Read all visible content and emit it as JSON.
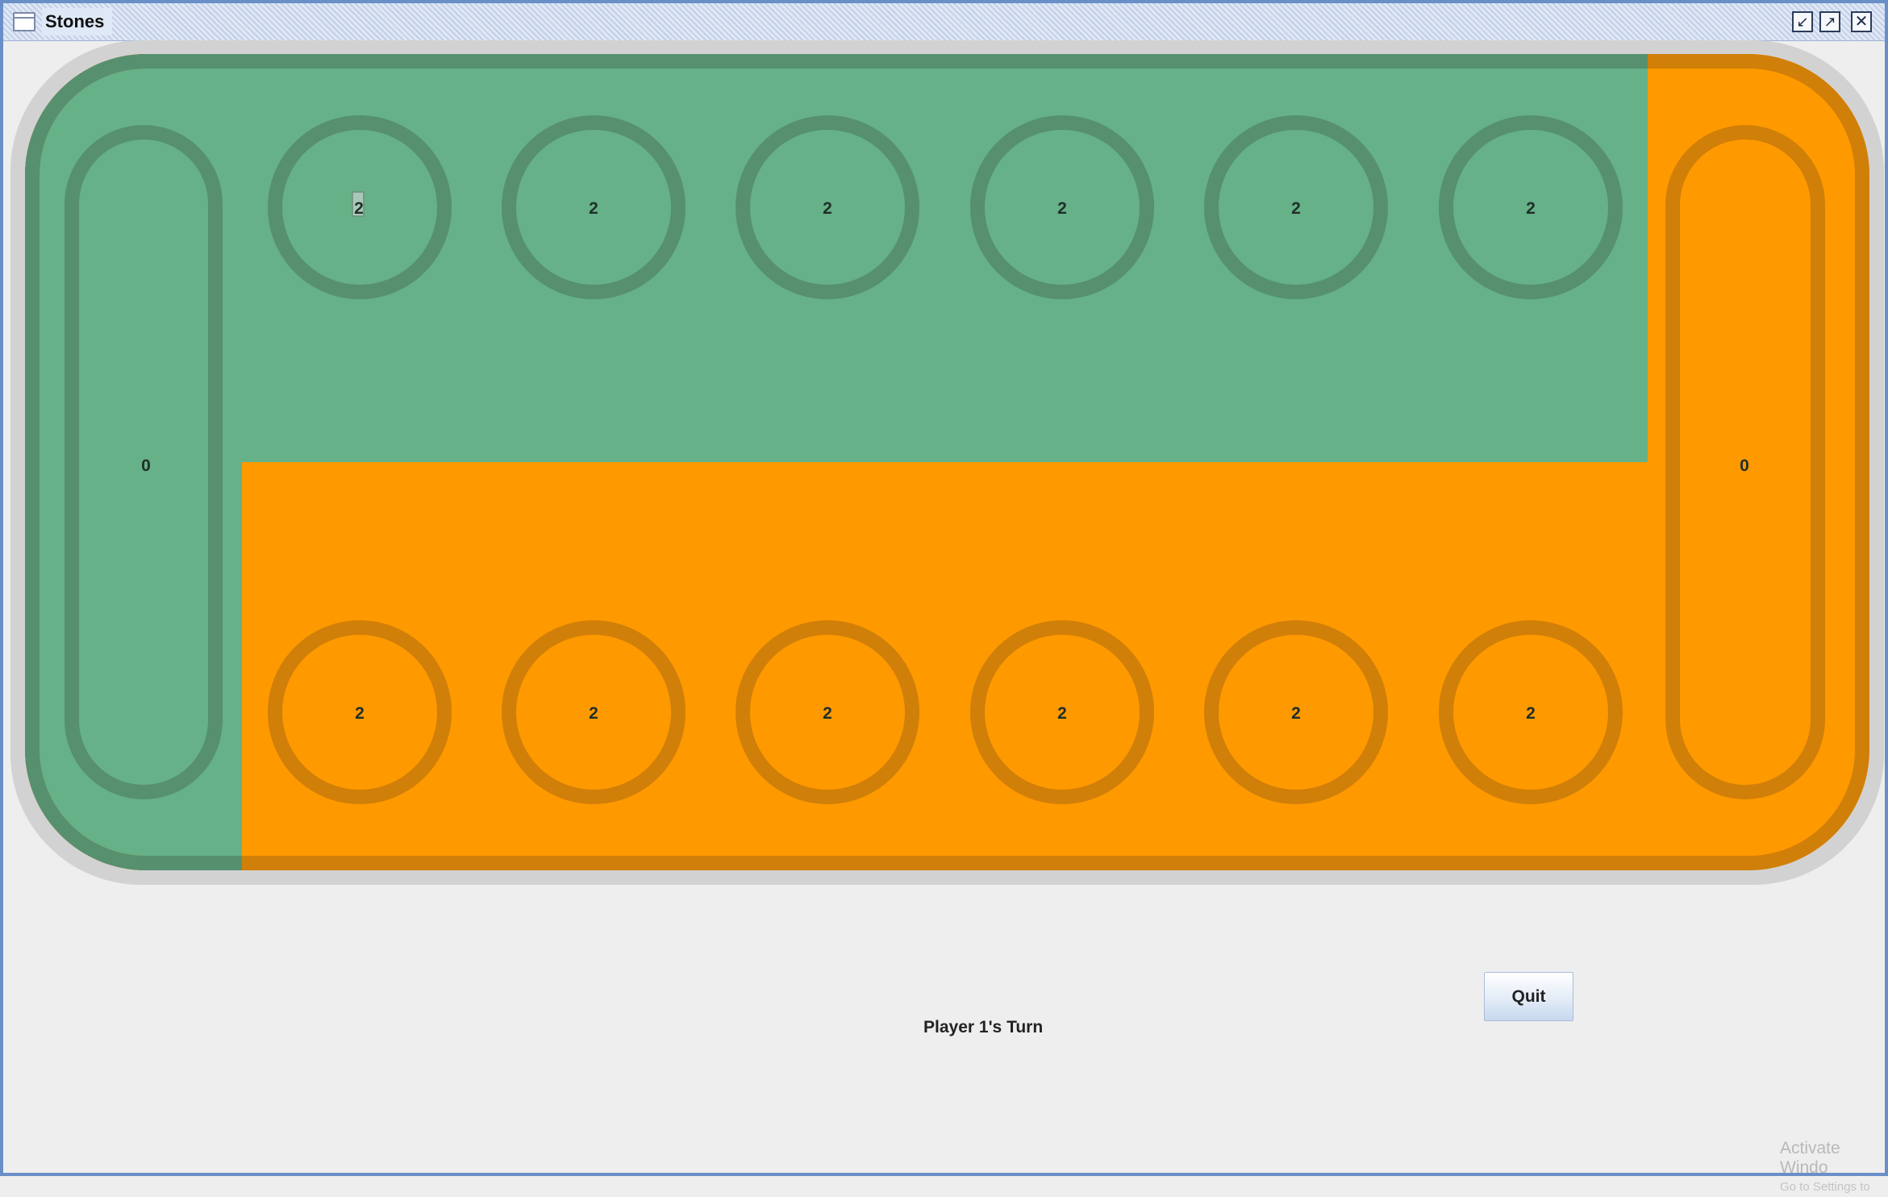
{
  "window": {
    "title": "Stones"
  },
  "title_buttons": {
    "minimize": "minimize-icon",
    "maximize": "maximize-icon",
    "close": "close-icon"
  },
  "board": {
    "colors": {
      "player1": "#66b187",
      "player1_ring": "#56906f",
      "player2": "#ff9900",
      "player2_ring": "#d07f09",
      "rim": "#d2d2d2"
    },
    "store_left": "0",
    "store_right": "0",
    "top_pits": [
      "2",
      "2",
      "2",
      "2",
      "2",
      "2"
    ],
    "bottom_pits": [
      "2",
      "2",
      "2",
      "2",
      "2",
      "2"
    ]
  },
  "status": {
    "turn": "Player 1's Turn"
  },
  "controls": {
    "quit_label": "Quit"
  },
  "watermark": {
    "line1": "Activate Windo",
    "line2": "Go to Settings to"
  }
}
